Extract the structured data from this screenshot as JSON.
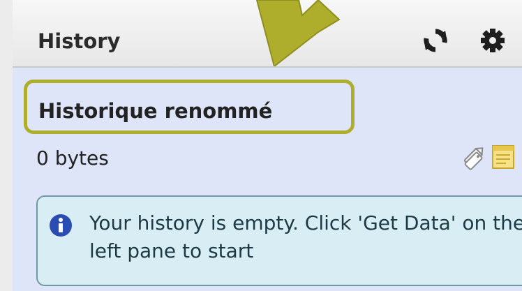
{
  "header": {
    "title": "History",
    "refresh_icon": "refresh-icon",
    "options_icon": "gear-icon"
  },
  "history": {
    "name": "Historique renommé",
    "size": "0 bytes",
    "tags_icon": "tags-icon",
    "annotation_icon": "note-icon"
  },
  "empty_message": {
    "icon": "info-icon",
    "text": "Your history is empty. Click 'Get Data' on the left pane to start"
  },
  "colors": {
    "panel_background": "#dfe5f9",
    "highlight_box": "#aeae2c",
    "arrow": "#aeae2c",
    "info_background": "#d9eef4",
    "info_icon": "#2a4db3"
  }
}
